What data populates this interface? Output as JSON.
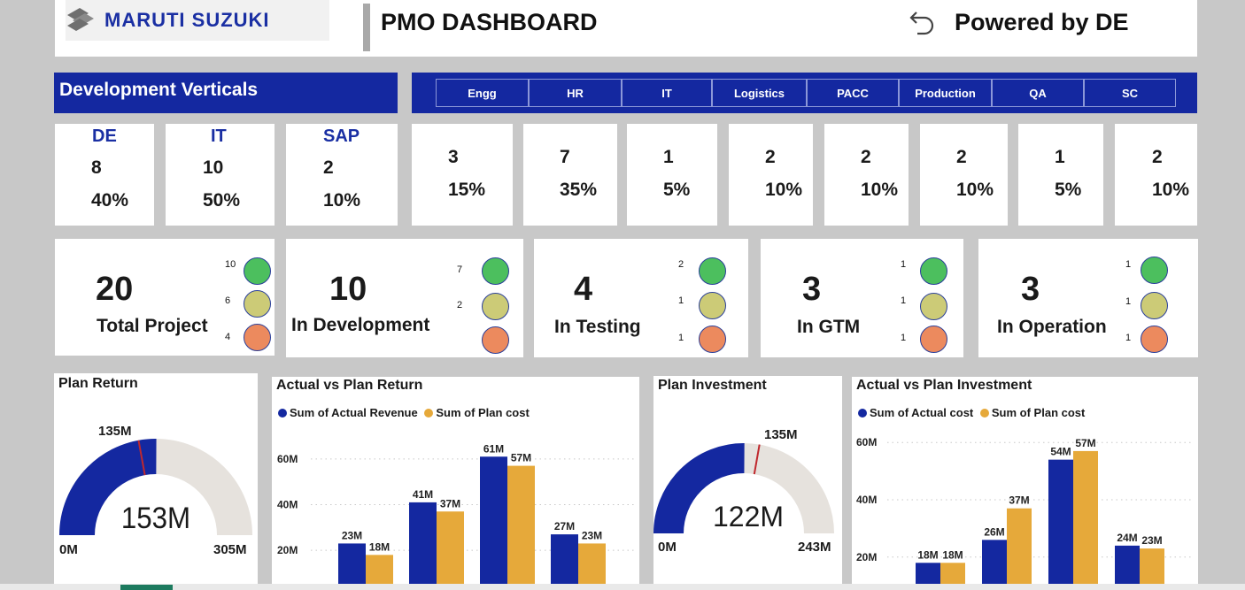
{
  "header": {
    "brand": "MARUTI SUZUKI",
    "title": "PMO DASHBOARD",
    "powered_by": "Powered by DE"
  },
  "dev": {
    "title": "Development Verticals",
    "tabs": [
      "Engg",
      "HR",
      "IT",
      "Logistics",
      "PACC",
      "Production",
      "QA",
      "SC"
    ],
    "verticals": [
      {
        "name": "DE",
        "count": "8",
        "pct": "40%"
      },
      {
        "name": "IT",
        "count": "10",
        "pct": "50%"
      },
      {
        "name": "SAP",
        "count": "2",
        "pct": "10%"
      }
    ],
    "departments": [
      {
        "count": "3",
        "pct": "15%"
      },
      {
        "count": "7",
        "pct": "35%"
      },
      {
        "count": "1",
        "pct": "5%"
      },
      {
        "count": "2",
        "pct": "10%"
      },
      {
        "count": "2",
        "pct": "10%"
      },
      {
        "count": "2",
        "pct": "10%"
      },
      {
        "count": "1",
        "pct": "5%"
      },
      {
        "count": "2",
        "pct": "10%"
      }
    ]
  },
  "status": [
    {
      "value": "20",
      "label": "Total Project",
      "green": "10",
      "yellow": "6",
      "orange": "4"
    },
    {
      "value": "10",
      "label": "In Development",
      "green": "7",
      "yellow": "2",
      "orange": ""
    },
    {
      "value": "4",
      "label": "In Testing",
      "green": "2",
      "yellow": "1",
      "orange": "1"
    },
    {
      "value": "3",
      "label": "In GTM",
      "green": "1",
      "yellow": "1",
      "orange": "1"
    },
    {
      "value": "3",
      "label": "In Operation",
      "green": "1",
      "yellow": "1",
      "orange": "1"
    }
  ],
  "colors": {
    "brand_blue": "#1428a0",
    "actual": "#1428a0",
    "plan": "#e6a93a",
    "gauge_track": "#e6e2dd",
    "target": "#c0282d"
  },
  "plan_return": {
    "title": "Plan Return",
    "value": "153M",
    "target": "135M",
    "min": "0M",
    "max": "305M",
    "value_num": 153,
    "target_num": 135,
    "max_num": 305
  },
  "plan_investment": {
    "title": "Plan Investment",
    "value": "122M",
    "target": "135M",
    "min": "0M",
    "max": "243M",
    "value_num": 122,
    "target_num": 135,
    "max_num": 243
  },
  "chart_data": [
    {
      "type": "bar",
      "title": "Actual vs Plan Return",
      "series": [
        {
          "name": "Sum of Actual Revenue",
          "values": [
            23,
            41,
            61,
            27
          ]
        },
        {
          "name": "Sum of Plan cost",
          "values": [
            18,
            37,
            57,
            23
          ]
        }
      ],
      "labels": [
        [
          "23M",
          "41M",
          "61M",
          "27M"
        ],
        [
          "18M",
          "37M",
          "57M",
          "23M"
        ]
      ],
      "yticks": [
        "20M",
        "40M",
        "60M"
      ],
      "ytick_values": [
        20,
        40,
        60
      ],
      "ylim": [
        10,
        70
      ]
    },
    {
      "type": "bar",
      "title": "Actual vs Plan Investment",
      "series": [
        {
          "name": "Sum of Actual cost",
          "values": [
            18,
            26,
            54,
            24
          ]
        },
        {
          "name": "Sum of Plan cost",
          "values": [
            18,
            37,
            57,
            23
          ]
        }
      ],
      "labels": [
        [
          "18M",
          "26M",
          "54M",
          "24M"
        ],
        [
          "18M",
          "37M",
          "57M",
          "23M"
        ]
      ],
      "yticks": [
        "20M",
        "40M",
        "60M"
      ],
      "ytick_values": [
        20,
        40,
        60
      ],
      "ylim": [
        15,
        65
      ]
    }
  ]
}
